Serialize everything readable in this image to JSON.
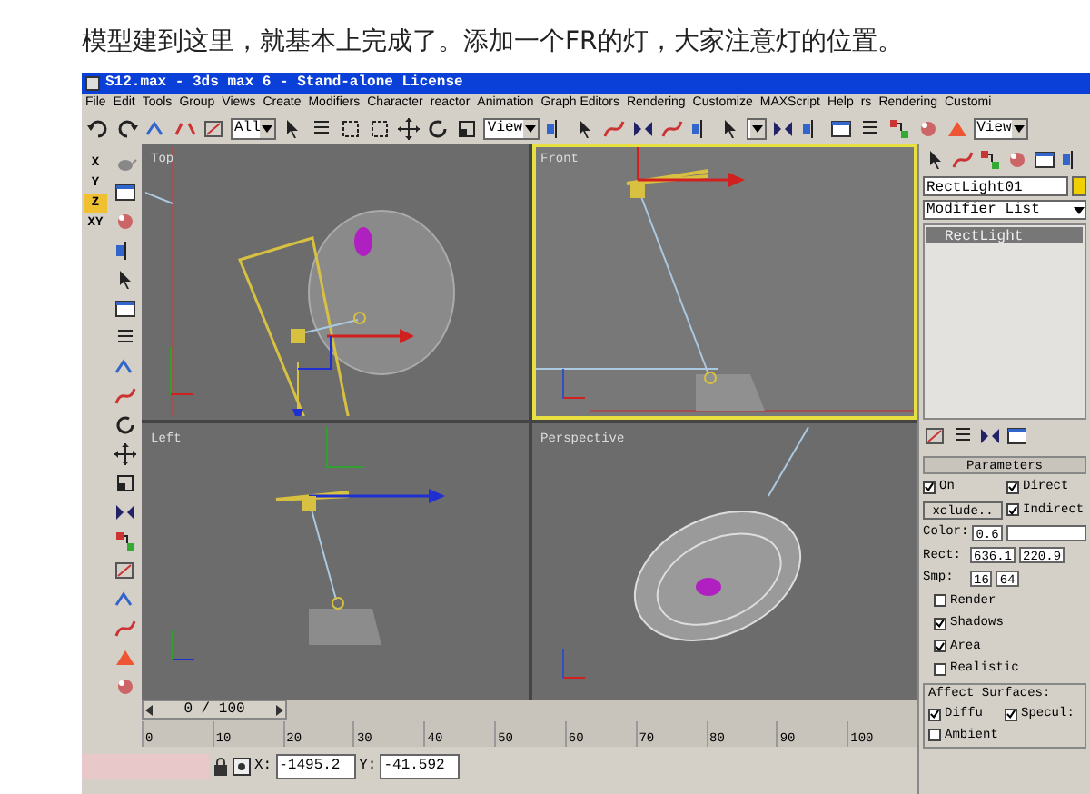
{
  "caption": "模型建到这里，就基本上完成了。添加一个FR的灯，大家注意灯的位置。",
  "window": {
    "title": "S12.max - 3ds max 6 - Stand-alone License"
  },
  "menu": [
    "File",
    "Edit",
    "Tools",
    "Group",
    "Views",
    "Create",
    "Modifiers",
    "Character",
    "reactor",
    "Animation",
    "Graph Editors",
    "Rendering",
    "Customize",
    "MAXScript",
    "Help",
    "rs",
    "Rendering",
    "Customi"
  ],
  "toolbar": {
    "selection_filter": "All",
    "reference_coord": "View",
    "view_dropdown": "View"
  },
  "axis_buttons": [
    {
      "label": "X",
      "selected": false
    },
    {
      "label": "Y",
      "selected": false
    },
    {
      "label": "Z",
      "selected": true
    },
    {
      "label": "XY",
      "selected": false
    }
  ],
  "viewports": [
    {
      "label": "Top",
      "kind": "top",
      "active": false
    },
    {
      "label": "Front",
      "kind": "front",
      "active": true
    },
    {
      "label": "Left",
      "kind": "left",
      "active": false
    },
    {
      "label": "Perspective",
      "kind": "perspective",
      "active": false
    }
  ],
  "command_panel": {
    "object_name": "RectLight01",
    "modifier_list": "Modifier List",
    "stack": [
      {
        "label": "RectLight",
        "selected": true
      }
    ]
  },
  "parameters": {
    "title": "Parameters",
    "on": {
      "label": "On",
      "checked": true
    },
    "direct": {
      "label": "Direct",
      "checked": true
    },
    "exclude_button": "xclude..",
    "indirect": {
      "label": "Indirect",
      "checked": true
    },
    "color": {
      "label": "Color:",
      "value": "0.6"
    },
    "rect": {
      "label": "Rect:",
      "values": [
        "636.1",
        "220.9"
      ]
    },
    "smp": {
      "label": "Smp:",
      "values": [
        "16",
        "64"
      ]
    },
    "checks": [
      {
        "label": "Render",
        "checked": false
      },
      {
        "label": "Shadows",
        "checked": true
      },
      {
        "label": "Area",
        "checked": true
      },
      {
        "label": "Realistic",
        "checked": false
      }
    ],
    "affect_surfaces": {
      "title": "Affect Surfaces:",
      "checks": [
        {
          "label": "Diffu",
          "checked": true
        },
        {
          "label": "Specul:",
          "checked": true
        },
        {
          "label": "Ambient",
          "checked": false
        }
      ]
    }
  },
  "time_slider": {
    "label": "0 / 100",
    "level": 0
  },
  "track_labels": [
    "0",
    "10",
    "20",
    "30",
    "40",
    "50",
    "60",
    "70",
    "80",
    "90",
    "100"
  ],
  "status": {
    "x_label": "X:",
    "x_value": "-1495.2",
    "y_label": "Y:",
    "y_value": "-41.592"
  }
}
